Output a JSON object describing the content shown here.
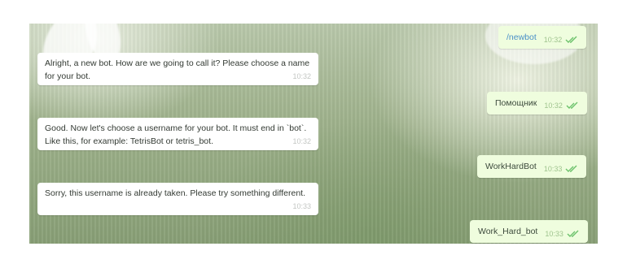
{
  "chat": {
    "messages": [
      {
        "direction": "out",
        "text": "/newbot",
        "time": "10:32",
        "status": "read",
        "icon": "double-check-icon",
        "color": "#5a9bd4"
      },
      {
        "direction": "in",
        "text": "Alright, a new bot. How are we going to call it? Please choose a name for your bot.",
        "time": "10:32"
      },
      {
        "direction": "out",
        "text": "Помощник",
        "time": "10:32",
        "status": "read",
        "icon": "double-check-icon"
      },
      {
        "direction": "in",
        "text": "Good. Now let's choose a username for your bot. It must end in `bot`. Like this, for example: TetrisBot or tetris_bot.",
        "time": "10:32"
      },
      {
        "direction": "out",
        "text": "WorkHardBot",
        "time": "10:33",
        "status": "read",
        "icon": "double-check-icon"
      },
      {
        "direction": "in",
        "text": "Sorry, this username is already taken. Please try something different.",
        "time": "10:33"
      },
      {
        "direction": "out",
        "text": "Work_Hard_bot",
        "time": "10:33",
        "status": "read",
        "icon": "double-check-icon"
      }
    ]
  },
  "colors": {
    "incoming_bubble": "#ffffff",
    "outgoing_bubble": "#effdde",
    "check_marks": "#6cc26b",
    "command_text": "#4a90c8"
  }
}
